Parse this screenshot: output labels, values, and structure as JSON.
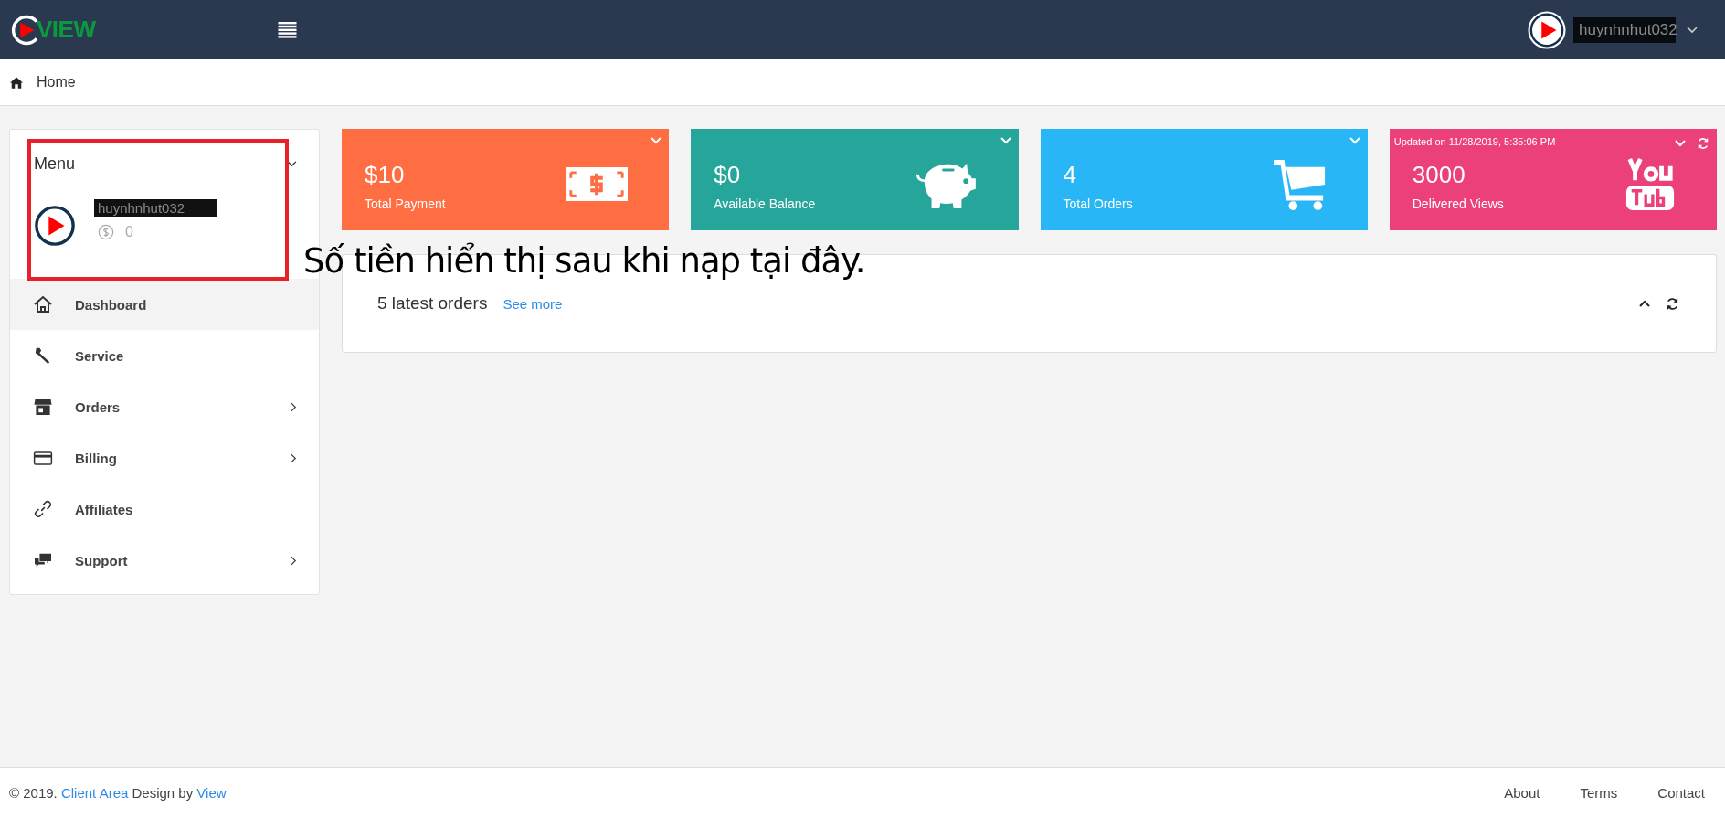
{
  "topbar": {
    "logo": "VIEW",
    "user": {
      "name": "huynhnhut032"
    }
  },
  "breadcrumb": [
    "Home"
  ],
  "sidebar": {
    "title": "Menu",
    "user": {
      "name": "huynhnhut032",
      "balance": "0"
    },
    "items": [
      {
        "label": "Dashboard",
        "selected": true,
        "submenu": false
      },
      {
        "label": "Service",
        "selected": false,
        "submenu": false
      },
      {
        "label": "Orders",
        "selected": false,
        "submenu": true
      },
      {
        "label": "Billing",
        "selected": false,
        "submenu": true
      },
      {
        "label": "Affiliates",
        "selected": false,
        "submenu": false
      },
      {
        "label": "Support",
        "selected": false,
        "submenu": true
      }
    ]
  },
  "cards": [
    {
      "value": "$10",
      "label": "Total Payment",
      "color": "#ff6d42"
    },
    {
      "value": "$0",
      "label": "Available Balance",
      "color": "#26a69a"
    },
    {
      "value": "4",
      "label": "Total Orders",
      "color": "#29b6f6"
    },
    {
      "value": "3000",
      "label": "Delivered Views",
      "color": "#ec407a",
      "updated": "Updated on 11/28/2019, 5:35:06 PM"
    }
  ],
  "orders_panel": {
    "title": "5 latest orders",
    "link": "See more"
  },
  "annotation": {
    "text": "Số tiền hiển thị sau khi nạp tại đây."
  },
  "footer": {
    "copyright": "© 2019.",
    "brand": "Client Area",
    "design": "Design by",
    "author": "View",
    "links": [
      "About",
      "Terms",
      "Contact"
    ]
  }
}
